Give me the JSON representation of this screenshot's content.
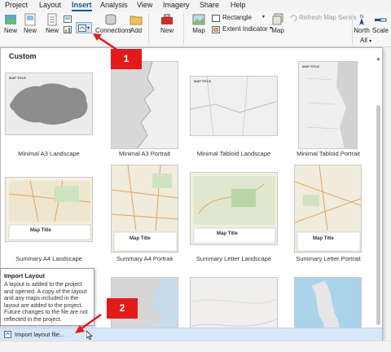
{
  "ribbon": {
    "tabs": [
      {
        "label": "Project",
        "active": false
      },
      {
        "label": "Layout",
        "active": false
      },
      {
        "label": "Insert",
        "active": true
      },
      {
        "label": "Analysis",
        "active": false
      },
      {
        "label": "View",
        "active": false
      },
      {
        "label": "Imagery",
        "active": false
      },
      {
        "label": "Share",
        "active": false
      },
      {
        "label": "Help",
        "active": false
      }
    ],
    "buttons": {
      "new1": "New",
      "new2": "New",
      "new3": "New",
      "connections": "Connections",
      "add": "Add",
      "new4": "New",
      "map1": "Map",
      "rectangle": "Rectangle",
      "extent_indicator": "Extent Indicator",
      "map2": "Map",
      "refresh_map_series": "Refresh Map Series",
      "north": "North",
      "scale": "Scale",
      "all": "All"
    }
  },
  "gallery": {
    "heading": "Custom",
    "map_title_label": "MAP TITLE",
    "map_title_strip": "Map Title",
    "items": [
      {
        "name": "Minimal A3 Landscape"
      },
      {
        "name": "Minimal A3 Portrait"
      },
      {
        "name": "Minimal Tabloid Landscape"
      },
      {
        "name": "Minimal Tabloid Portrait"
      },
      {
        "name": "Summary A4 Landscape"
      },
      {
        "name": "Summary A4 Portrait"
      },
      {
        "name": "Summary Letter Landscape"
      },
      {
        "name": "Summary Letter Portrait"
      }
    ]
  },
  "tooltip": {
    "title": "Import Layout",
    "body": "A layout is added to the project and opened. A copy of the layout and any maps included in the layout are added to the project. Future changes to the file are not reflected in the project."
  },
  "import_bar": {
    "label": "Import layout file..."
  },
  "callouts": {
    "one": "1",
    "two": "2"
  },
  "colors": {
    "callout_red": "#e21a1a",
    "highlight_blue": "#d6e7f8",
    "active_tab": "#1a4f9c"
  }
}
